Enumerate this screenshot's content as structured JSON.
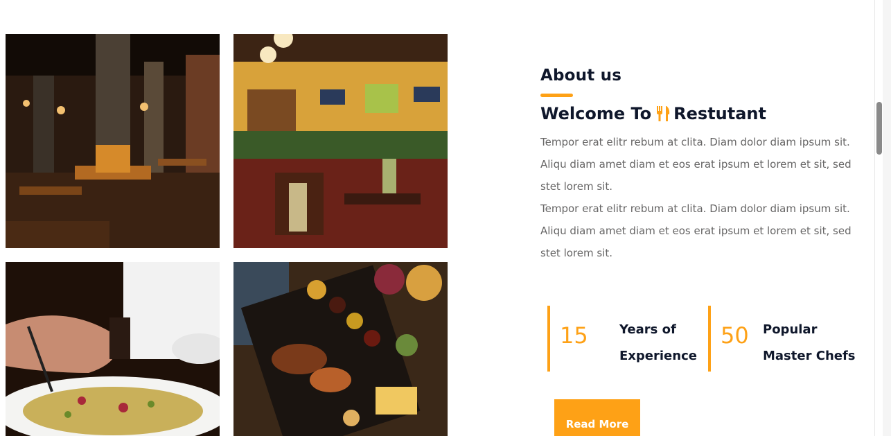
{
  "about": {
    "label": "About us",
    "welcome_prefix": "Welcome To",
    "welcome_suffix": "Restutant",
    "paragraphs": [
      "Tempor erat elitr rebum at clita. Diam dolor diam ipsum sit. Aliqu diam amet diam et eos erat ipsum et lorem et sit, sed stet lorem sit.",
      "Tempor erat elitr rebum at clita. Diam dolor diam ipsum sit. Aliqu diam amet diam et eos erat ipsum et lorem et sit, sed stet lorem sit."
    ]
  },
  "stats": [
    {
      "number": "15",
      "label_line1": "Years of",
      "label_line2": "Experience"
    },
    {
      "number": "50",
      "label_line1": "Popular",
      "label_line2": "Master Chefs"
    }
  ],
  "read_more_label": "Read More",
  "icons": {
    "welcome_icon": "utensils-icon"
  },
  "colors": {
    "accent": "#fea116",
    "heading": "#0f172b",
    "body_text": "#666565"
  }
}
